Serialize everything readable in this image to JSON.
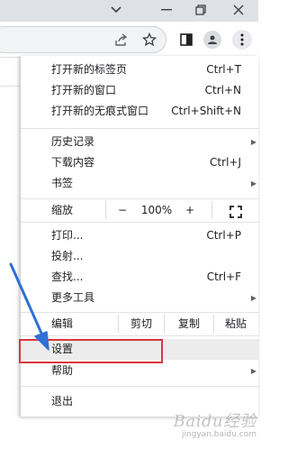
{
  "window": {
    "controls": {
      "chevron": "chevron-down-icon",
      "minimize": "minimize-icon",
      "restore": "restore-icon",
      "close": "close-icon"
    }
  },
  "toolbar": {
    "icons": [
      "share-icon",
      "star-icon",
      "side-panel-icon",
      "profile-icon",
      "kebab-menu-icon"
    ]
  },
  "menu": {
    "group1": [
      {
        "label": "打开新的标签页",
        "shortcut": "Ctrl+T"
      },
      {
        "label": "打开新的窗口",
        "shortcut": "Ctrl+N"
      },
      {
        "label": "打开新的无痕式窗口",
        "shortcut": "Ctrl+Shift+N"
      }
    ],
    "group2": [
      {
        "label": "历史记录",
        "shortcut": ""
      },
      {
        "label": "下载内容",
        "shortcut": "Ctrl+J"
      },
      {
        "label": "书签",
        "shortcut": ""
      }
    ],
    "zoom": {
      "label": "缩放",
      "minus": "−",
      "value": "100%",
      "plus": "+"
    },
    "group3": [
      {
        "label": "打印...",
        "shortcut": "Ctrl+P"
      },
      {
        "label": "投射...",
        "shortcut": ""
      },
      {
        "label": "查找...",
        "shortcut": "Ctrl+F"
      },
      {
        "label": "更多工具",
        "shortcut": ""
      }
    ],
    "edit": {
      "label": "编辑",
      "cut": "剪切",
      "copy": "复制",
      "paste": "粘贴"
    },
    "settings": {
      "label": "设置"
    },
    "help": {
      "label": "帮助"
    },
    "exit": {
      "label": "退出"
    }
  },
  "watermark": {
    "brand": "Baidu经验",
    "url": "jingyan.baidu.com"
  },
  "colors": {
    "highlight_box": "#d9363e",
    "annotation_arrow": "#2f6fd6",
    "hover_row": "#ececec"
  }
}
